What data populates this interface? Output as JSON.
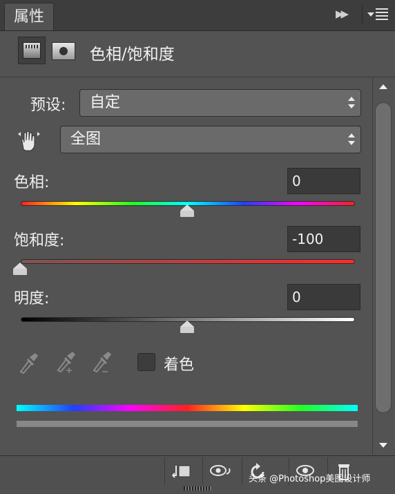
{
  "tab": {
    "label": "属性"
  },
  "header": {
    "title": "色相/饱和度"
  },
  "preset": {
    "label": "预设:",
    "value": "自定"
  },
  "channel": {
    "value": "全图"
  },
  "hue": {
    "label": "色相:",
    "value": "0",
    "level": 0.5
  },
  "saturation": {
    "label": "饱和度:",
    "value": "-100",
    "level": 0.0
  },
  "lightness": {
    "label": "明度:",
    "value": "0",
    "level": 0.5
  },
  "colorize": {
    "label": "着色",
    "checked": false
  },
  "icons": {
    "collapse": "double-chevron-right-icon",
    "panel_menu": "panel-menu-icon",
    "adjustment": "hue-saturation-adjustment-icon",
    "mask": "layer-mask-icon",
    "hand": "targeted-adjustment-hand-icon",
    "droppers": [
      "eyedropper-icon",
      "eyedropper-plus-icon",
      "eyedropper-minus-icon"
    ],
    "bottom": [
      "clip-to-layer-icon",
      "view-previous-state-icon",
      "reset-icon",
      "visibility-eye-icon",
      "trash-icon"
    ]
  },
  "watermark": {
    "text": "头条 @Photoshop美图设计师"
  },
  "colors": {
    "panel_bg": "#535353",
    "tabbar_bg": "#3d3d3d",
    "field_bg": "#3a3a3a",
    "select_bg": "#6a6a6a"
  }
}
